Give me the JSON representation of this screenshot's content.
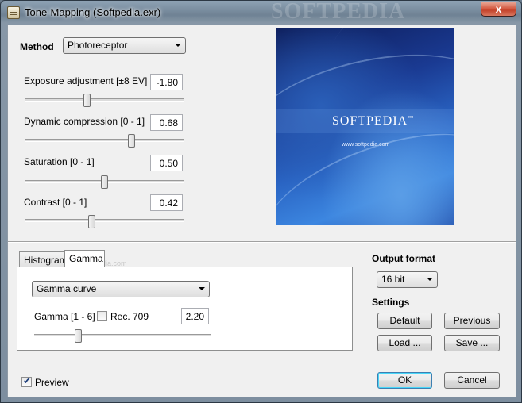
{
  "window": {
    "title": "Tone-Mapping (Softpedia.exr)",
    "title_watermark": "SOFTPEDIA",
    "close_label": "x"
  },
  "method": {
    "label": "Method",
    "selected": "Photoreceptor"
  },
  "parameters": [
    {
      "label": "Exposure adjustment [±8 EV]",
      "value": "-1.80",
      "slider_fraction": 0.39
    },
    {
      "label": "Dynamic compression [0 - 1]",
      "value": "0.68",
      "slider_fraction": 0.68
    },
    {
      "label": "Saturation [0 - 1]",
      "value": "0.50",
      "slider_fraction": 0.5
    },
    {
      "label": "Contrast [0 - 1]",
      "value": "0.42",
      "slider_fraction": 0.42
    }
  ],
  "preview_image": {
    "logo_text": "SOFTPEDIA",
    "logo_mark": "™",
    "url_text": "www.softpedia.com"
  },
  "tabs": {
    "items": [
      {
        "label": "Histogram",
        "active": false
      },
      {
        "label": "Gamma",
        "active": true
      }
    ],
    "watermark": "www.softpedia.com"
  },
  "gamma": {
    "curve_selected": "Gamma curve",
    "label": "Gamma [1 - 6]",
    "rec709_label": "Rec. 709",
    "rec709_checked": false,
    "value": "2.20",
    "slider_fraction": 0.24
  },
  "output_format": {
    "label": "Output format",
    "selected": "16 bit"
  },
  "settings": {
    "label": "Settings",
    "default_label": "Default",
    "previous_label": "Previous",
    "load_label": "Load ...",
    "save_label": "Save ..."
  },
  "footer": {
    "preview_label": "Preview",
    "preview_checked": true,
    "ok_label": "OK",
    "cancel_label": "Cancel"
  }
}
